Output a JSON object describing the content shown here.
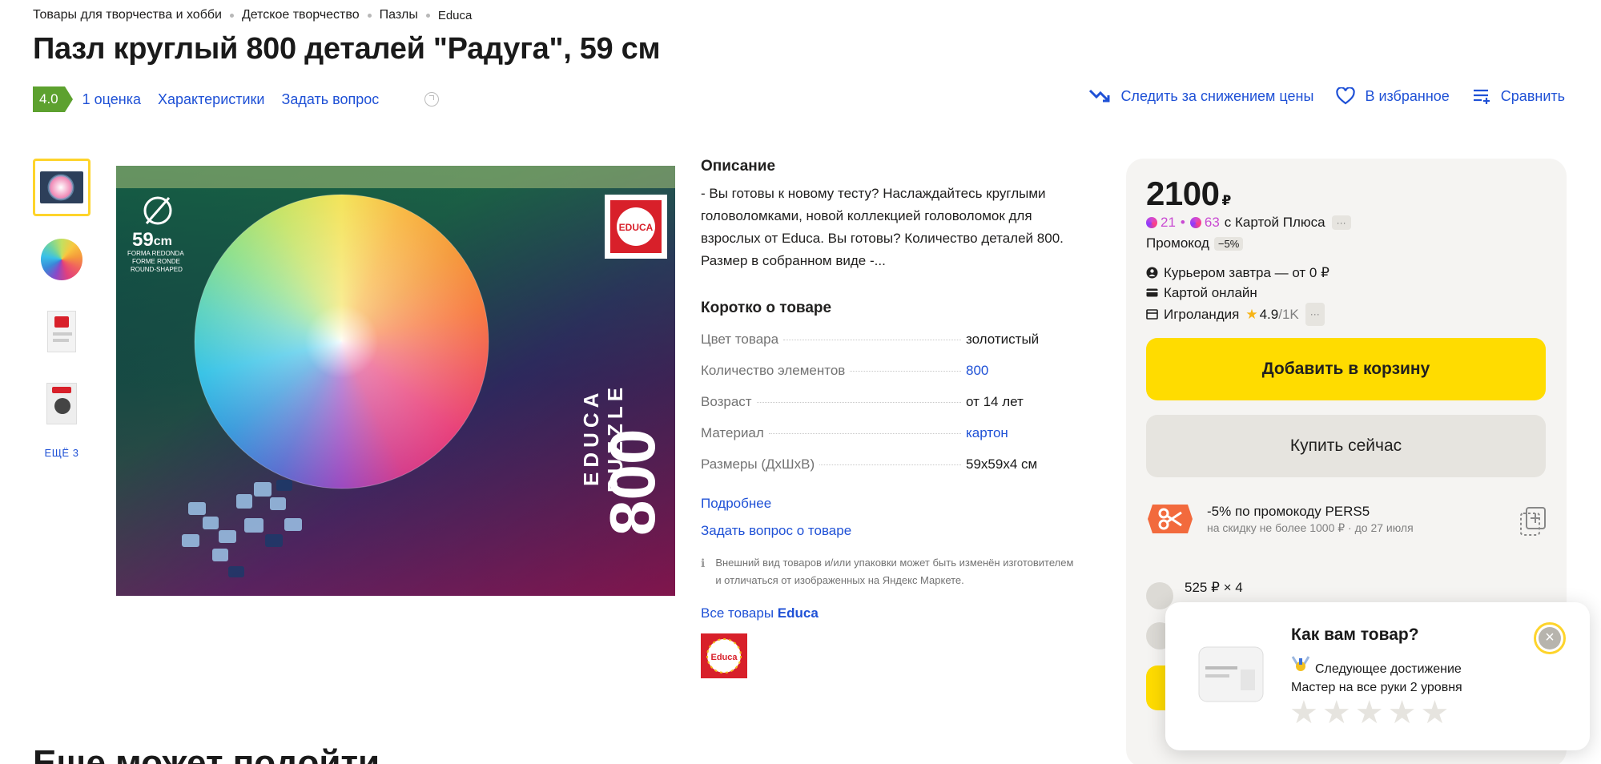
{
  "breadcrumbs": [
    "Товары для творчества и хобби",
    "Детское творчество",
    "Пазлы",
    "Educa"
  ],
  "title": "Пазл круглый 800 деталей \"Радуга\", 59 см",
  "rating": {
    "value": "4.0",
    "reviews_label": "1 оценка",
    "specs_link": "Характеристики",
    "ask_link": "Задать вопрос"
  },
  "actions": {
    "track_price": "Следить за снижением цены",
    "favorite": "В избранное",
    "compare": "Сравнить"
  },
  "thumbnails": {
    "more_label": "ЕЩЁ 3"
  },
  "product_image": {
    "size_label": "59",
    "size_unit": "cm",
    "shape_lines": [
      "FORMA REDONDA",
      "FORME RONDE",
      "ROUND-SHAPED"
    ],
    "brand": "EDUCA",
    "count": "800",
    "text_vertical_1": "EDUCA",
    "text_vertical_2": "PUZZLE"
  },
  "description": {
    "title": "Описание",
    "text": "- Вы готовы к новому тесту? Наслаждайтесь круглыми головоломками, новой коллекцией головоломок для взрослых от Educa. Вы готовы? Количество деталей 800. Размер в собранном виде -..."
  },
  "short_info": {
    "title": "Коротко о товаре",
    "specs": [
      {
        "key": "Цвет товара",
        "value": "золотистый",
        "is_link": false
      },
      {
        "key": "Количество элементов",
        "value": "800",
        "is_link": true
      },
      {
        "key": "Возраст",
        "value": "от 14 лет",
        "is_link": false
      },
      {
        "key": "Материал",
        "value": "картон",
        "is_link": true
      },
      {
        "key": "Размеры (ДхШхВ)",
        "value": "59x59x4 см",
        "is_link": false
      }
    ],
    "more_link": "Подробнее",
    "ask_link": "Задать вопрос о товаре",
    "notice": "Внешний вид товаров и/или упаковки может быть изменён изготовителем и отличаться от изображенных на Яндекс Маркете.",
    "all_goods_prefix": "Все товары",
    "brand_name": "Educa"
  },
  "buybox": {
    "price": "2100",
    "currency": "₽",
    "plus_points_1": "21",
    "plus_points_2": "63",
    "plus_card_text": "с Картой Плюса",
    "more_pill": "···",
    "promo_label": "Промокод",
    "promo_discount": "−5%",
    "delivery": "Курьером завтра — от 0 ₽",
    "payment": "Картой онлайн",
    "seller": "Игроландия",
    "seller_rating": "4.9",
    "seller_reviews": "/1K",
    "add_to_cart": "Добавить в корзину",
    "buy_now": "Купить сейчас",
    "coupon_main": "-5% по промокоду PERS5",
    "coupon_sub": "на скидку не более 1000 ₽ · до 27 июля",
    "split_payment": "525 ₽ × 4"
  },
  "popup": {
    "title": "Как вам товар?",
    "line1": "Следующее достижение",
    "line2": "Мастер на все руки 2 уровня",
    "stars": 5
  },
  "more_section_title": "Еще может подойти"
}
